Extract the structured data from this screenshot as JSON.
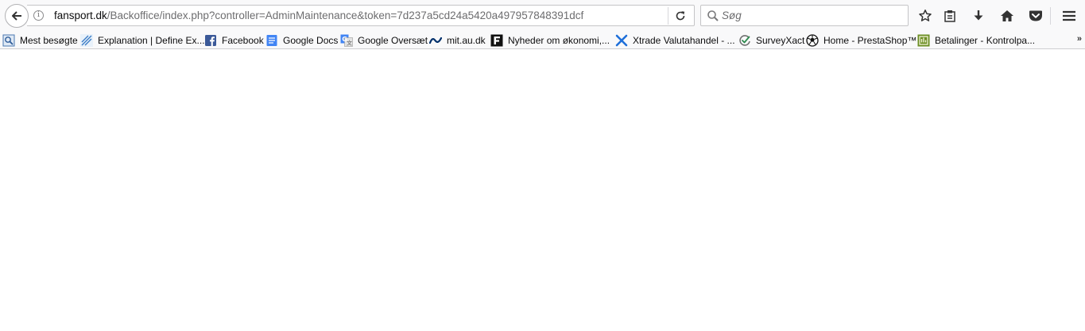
{
  "toolbar": {
    "url_host": "fansport.dk",
    "url_path": "/Backoffice/index.php?controller=AdminMaintenance&token=7d237a5cd24a5420a497957848391dcf",
    "search_placeholder": "Søg",
    "info_glyph": "i"
  },
  "bookmarks": {
    "items": [
      {
        "label": "Mest besøgte",
        "icon": "most-visited-icon"
      },
      {
        "label": "Explanation | Define Ex...",
        "icon": "explanation-site-icon"
      },
      {
        "label": "Facebook",
        "icon": "facebook-icon"
      },
      {
        "label": "Google Docs",
        "icon": "google-docs-icon"
      },
      {
        "label": "Google Oversæt",
        "icon": "google-translate-icon"
      },
      {
        "label": "mit.au.dk",
        "icon": "au-icon"
      },
      {
        "label": "Nyheder om økonomi,...",
        "icon": "finans-icon"
      },
      {
        "label": "Xtrade Valutahandel - ...",
        "icon": "xtrade-icon"
      },
      {
        "label": "SurveyXact",
        "icon": "surveyxact-icon"
      },
      {
        "label": "Home - PrestaShop™",
        "icon": "prestashop-icon"
      },
      {
        "label": "Betalinger - Kontrolpa...",
        "icon": "payments-icon"
      }
    ],
    "overflow_glyph": "»"
  },
  "colors": {
    "toolbar_bg": "#f9f9fa",
    "facebook": "#3b5998",
    "google_docs": "#4285f4",
    "xtrade": "#1e6fd9",
    "betalinger": "#6b8e23"
  }
}
